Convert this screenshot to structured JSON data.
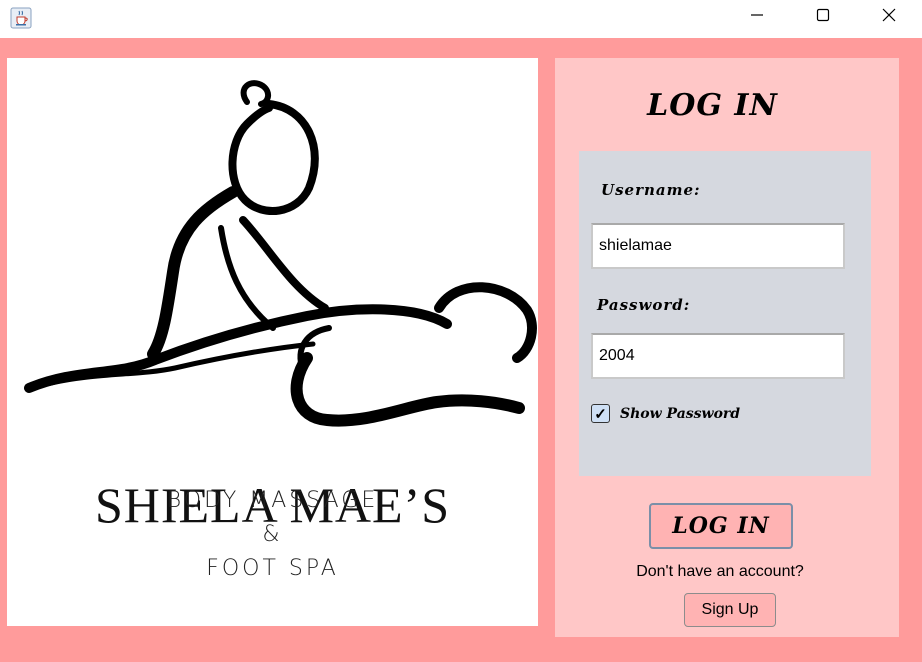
{
  "window": {
    "icon": "java-cup-icon",
    "controls": [
      "minimize-icon",
      "maximize-icon",
      "close-icon"
    ]
  },
  "brand": {
    "name": "SHIELA MAE’S",
    "line1": "BODY MASSAGE",
    "line2": "&",
    "line3": "FOOT SPA"
  },
  "login": {
    "heading": "LOG IN",
    "username_label": "Username:",
    "username_value": "shielamae",
    "password_label": "Password:",
    "password_value": "2004",
    "show_password_label": "Show Password",
    "show_password_checked": true,
    "login_button": "LOG IN",
    "no_account_text": "Don't have an account?",
    "signup_button": "Sign Up"
  },
  "colors": {
    "frame": "#ff9b9b",
    "panel": "#ffc7c7",
    "form_box": "#d5d8df",
    "button": "#ffb3b3"
  }
}
